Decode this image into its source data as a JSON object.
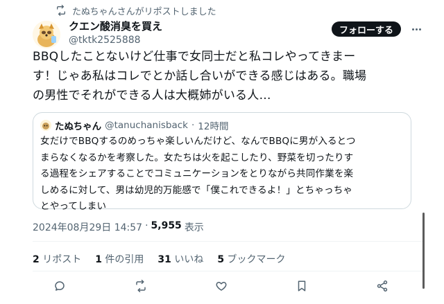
{
  "repost_banner": {
    "text": "たぬちゃんさんがリポストしました",
    "icon": "repost-icon"
  },
  "author": {
    "name": "クエン酸消臭を買え",
    "handle": "@tktk2525888"
  },
  "follow_label": "フォローする",
  "tweet_text": "BBQしたことないけど仕事で女同士だと私コレやってきまー\nす！じゃあ私はコレでとか話し合いができる感じはある。職場\nの男性でそれができる人は大概姉がいる人…",
  "quote": {
    "name": "たぬちゃん",
    "handle": "@tanuchanisback",
    "separator": "·",
    "time": "12時間",
    "text": "女だけでBBQするのめっちゃ楽しいんだけど、なんでBBQに男が入るとつ\nまらなくなるかを考察した。女たちは火を起こしたり、野菜を切ったりす\nる過程をシェアすることでコミュニケーションをとりながら共同作業を楽\nしめるに対して、男は幼児的万能感で「僕これできるよ！」とちゃっちゃ\nとやってしまい"
  },
  "meta": {
    "timestamp": "2024年08月29日 14:57",
    "separator": "·",
    "views_count": "5,955",
    "views_label": "表示"
  },
  "stats": [
    {
      "count": "2",
      "label": "リポスト"
    },
    {
      "count": "1",
      "label": "件の引用"
    },
    {
      "count": "31",
      "label": "いいね"
    },
    {
      "count": "5",
      "label": "ブックマーク"
    }
  ],
  "actions": [
    "reply-icon",
    "repost-icon",
    "like-icon",
    "bookmark-icon",
    "share-icon"
  ],
  "colors": {
    "text": "#0f1419",
    "secondary": "#536471",
    "border": "#cfd9de",
    "button": "#0f1419"
  }
}
